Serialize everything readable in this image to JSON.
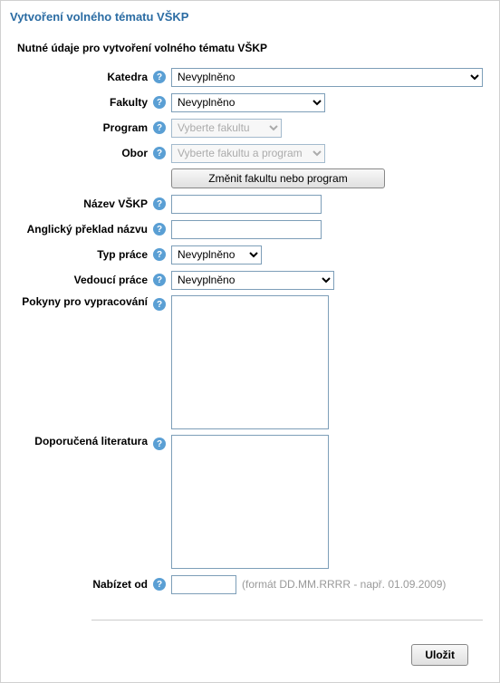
{
  "page": {
    "title": "Vytvoření volného tématu VŠKP"
  },
  "section": {
    "required_label": "Nutné údaje pro vytvoření volného tématu VŠKP"
  },
  "form": {
    "katedra": {
      "label": "Katedra",
      "value": "Nevyplněno"
    },
    "fakulty": {
      "label": "Fakulty",
      "value": "Nevyplněno"
    },
    "program": {
      "label": "Program",
      "placeholder": "Vyberte fakultu"
    },
    "obor": {
      "label": "Obor",
      "placeholder": "Vyberte fakultu a program"
    },
    "change_button": "Změnit fakultu nebo program",
    "nazev": {
      "label": "Název VŠKP",
      "value": ""
    },
    "anglicky": {
      "label": "Anglický překlad názvu",
      "value": ""
    },
    "typprace": {
      "label": "Typ práce",
      "value": "Nevyplněno"
    },
    "vedouci": {
      "label": "Vedoucí práce",
      "value": "Nevyplněno"
    },
    "pokyny": {
      "label": "Pokyny pro vypracování",
      "value": ""
    },
    "literatura": {
      "label": "Doporučená literatura",
      "value": ""
    },
    "nabizet": {
      "label": "Nabízet od",
      "value": "",
      "hint": "(formát DD.MM.RRRR - např. 01.09.2009)"
    },
    "save_button": "Uložit"
  }
}
